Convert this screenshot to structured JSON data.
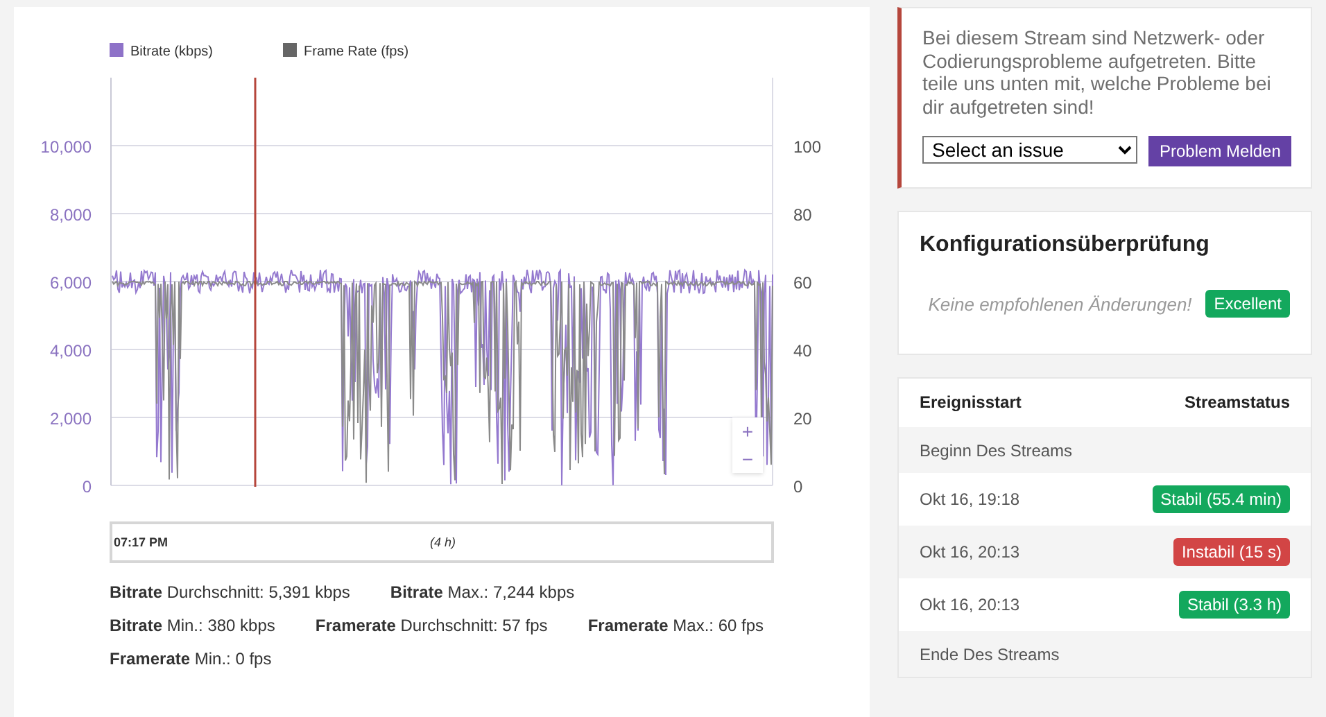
{
  "chart": {
    "legend": [
      {
        "label": "Bitrate (kbps)",
        "color": "#8e72c8"
      },
      {
        "label": "Frame Rate (fps)",
        "color": "#666666"
      }
    ],
    "left_ticks": [
      "10,000",
      "8,000",
      "6,000",
      "4,000",
      "2,000",
      "0"
    ],
    "right_ticks": [
      "100",
      "80",
      "60",
      "40",
      "20",
      "0"
    ],
    "zoom_in": "+",
    "zoom_out": "−",
    "navigator": {
      "start": "07:17 PM",
      "range": "(4 h)"
    }
  },
  "stat_rows": [
    [
      "**Bitrate** Durchschnitt: 5,391 kbps",
      "**Bitrate** Max.: 7,244 kbps"
    ],
    [
      "**Bitrate** Min.: 380 kbps",
      "**Framerate** Durchschnitt: 57 fps",
      "**Framerate** Max.: 60 fps"
    ],
    [
      "**Framerate** Min.: 0 fps"
    ]
  ],
  "alert": {
    "message": "Bei diesem Stream sind Netzwerk- oder Codierungsprobleme aufgetreten. Bitte teile uns unten mit, welche Probleme bei dir aufgetreten sind!",
    "select": "Select an issue",
    "button": "Problem Melden"
  },
  "config": {
    "title": "Konfigurationsüberprüfung",
    "note": "Keine empfohlenen Änderungen!",
    "badge": "Excellent"
  },
  "events": {
    "columns": [
      "Ereignisstart",
      "Streamstatus"
    ],
    "rows": [
      {
        "time": "Beginn Des Streams"
      },
      {
        "time": "Okt 16, 19:18",
        "status": "Stabil (55.4 min)",
        "kind": "stable"
      },
      {
        "time": "Okt 16, 20:13",
        "status": "Instabil (15 s)",
        "kind": "unstable"
      },
      {
        "time": "Okt 16, 20:13",
        "status": "Stabil (3.3 h)",
        "kind": "stable"
      },
      {
        "time": "Ende Des Streams"
      }
    ]
  }
}
